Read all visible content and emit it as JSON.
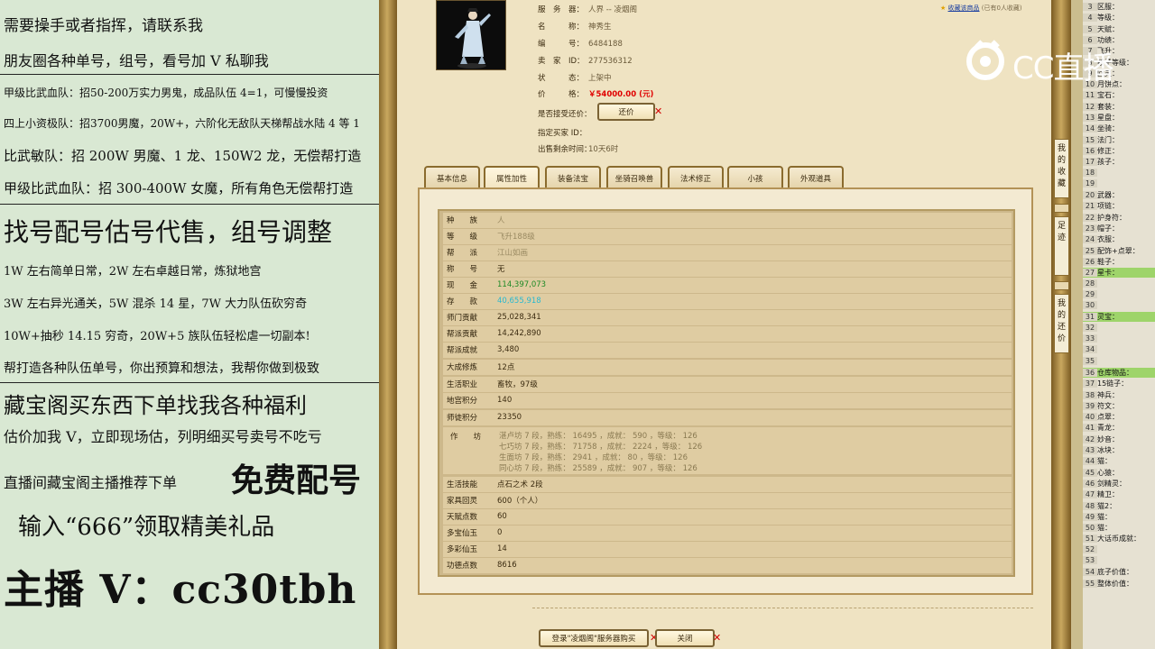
{
  "left_panel": {
    "lines": [
      "需要操手或者指挥，请联系我",
      "朋友圈各种单号，组号，看号加 V 私聊我",
      "甲级比武血队：招50-200万实力男鬼，成品队伍 4=1，可慢慢投资",
      "四上小资极队：招3700男魔，20W+，六阶化无敌队天梯帮战水陆 4 等 1",
      "比武敏队：招 200W 男魔、1 龙、150W2 龙，无偿帮打造",
      "甲级比武血队：招 300-400W 女魔，所有角色无偿帮打造",
      "找号配号估号代售，组号调整",
      "1W 左右简单日常，2W 左右卓越日常，炼狱地宫",
      "3W 左右异光通关，5W 混杀 14 星，7W 大力队伍砍穷奇",
      "10W+抽秒 14.15 穷奇，20W+5 族队伍轻松虐一切副本!",
      "帮打造各种队伍单号，你出预算和想法，我帮你做到极致",
      "藏宝阁买东西下单找我各种福利",
      "估价加我 V，立即现场估，列明细买号卖号不吃亏",
      "直播间藏宝阁主播推荐下单",
      "免费配号",
      "输入“666”领取精美礼品",
      "主播 V：cc30tbh"
    ]
  },
  "header": {
    "favorite_link": "收藏该商品",
    "favorite_count": "(已有0人收藏)",
    "rows": [
      {
        "label": "服　务　器：",
        "value": "人界 -- 凌烟阁"
      },
      {
        "label": "名　　　称：",
        "value": "神秀生"
      },
      {
        "label": "编　　　号：",
        "value": "6484188"
      },
      {
        "label": "卖　家　ID：",
        "value": "277536312"
      },
      {
        "label": "状　　　态：",
        "value": "上架中"
      },
      {
        "label": "价　　　格：",
        "value": "￥54000.00 (元)"
      },
      {
        "label": "是否接受还价：",
        "value": ""
      },
      {
        "label": "指定买家 ID：",
        "value": ""
      },
      {
        "label": "出售剩余时间：",
        "value": "10天6时"
      }
    ],
    "bargain_button": "还价"
  },
  "tabs": [
    "基本信息",
    "属性加性",
    "装备法宝",
    "坐骑召唤兽",
    "法术修正",
    "小孩",
    "外观道具"
  ],
  "table": {
    "rows": [
      {
        "label": "种　　族",
        "value": "人",
        "style": "muted"
      },
      {
        "label": "等　　级",
        "value": "飞升188级",
        "style": "muted"
      },
      {
        "label": "帮　　派",
        "value": "江山如画",
        "style": "muted"
      },
      {
        "label": "称　　号",
        "value": "无",
        "style": ""
      },
      {
        "label": "现　　金",
        "value": "114,397,073",
        "style": "green"
      },
      {
        "label": "存　　款",
        "value": "40,655,918",
        "style": "cyan"
      },
      {
        "label": "师门贡献",
        "value": "25,028,341",
        "style": ""
      },
      {
        "label": "帮派贡献",
        "value": "14,242,890",
        "style": ""
      },
      {
        "label": "帮派成就",
        "value": "3,480",
        "style": ""
      },
      {
        "label": "大成修炼",
        "value": "12点",
        "style": ""
      },
      {
        "label": "生活职业",
        "value": "畜牧，97级",
        "style": ""
      },
      {
        "label": "地宫积分",
        "value": "140",
        "style": ""
      },
      {
        "label": "师徒积分",
        "value": "23350",
        "style": ""
      }
    ],
    "workshop_label": "作　　坊",
    "workshop": [
      "湛卢坊 7 段，熟练： 16495 ，成就： 590 ，等级： 126",
      "七巧坊 7 段，熟练： 71758 ，成就： 2224 ，等级： 126",
      "生面坊 7 段，熟练： 2941 ，成就： 80 ，等级： 126",
      "同心坊 7 段，熟练： 25589 ，成就： 907 ，等级： 126"
    ],
    "rows2": [
      {
        "label": "生活技能",
        "value": "点石之术 2段"
      },
      {
        "label": "家具回灵",
        "value": "600（个人）"
      },
      {
        "label": "天赋点数",
        "value": "60"
      },
      {
        "label": "多宝仙玉",
        "value": "0"
      },
      {
        "label": "多彩仙玉",
        "value": "14"
      },
      {
        "label": "功德点数",
        "value": "8616"
      }
    ]
  },
  "bottom_buttons": {
    "login_buy": "登录\"凌烟阁\"服务器购买",
    "close": "关闭"
  },
  "side_tabs": [
    "我的收藏",
    "足迹",
    "我的还价"
  ],
  "watermark": "CC直播",
  "right_list": [
    {
      "n": "3",
      "t": "区服："
    },
    {
      "n": "4",
      "t": "等级："
    },
    {
      "n": "5",
      "t": "天赋："
    },
    {
      "n": "6",
      "t": "功绩："
    },
    {
      "n": "7",
      "t": "飞升："
    },
    {
      "n": "8",
      "t": "孩子等级："
    },
    {
      "n": "9",
      "t": "回灵："
    },
    {
      "n": "10",
      "t": "月饼点："
    },
    {
      "n": "11",
      "t": "宝石："
    },
    {
      "n": "12",
      "t": "套装："
    },
    {
      "n": "13",
      "t": "星盘："
    },
    {
      "n": "14",
      "t": "坐骑："
    },
    {
      "n": "15",
      "t": "法门："
    },
    {
      "n": "16",
      "t": "修正："
    },
    {
      "n": "17",
      "t": "孩子："
    },
    {
      "n": "18",
      "t": ""
    },
    {
      "n": "19",
      "t": ""
    },
    {
      "n": "20",
      "t": "武器："
    },
    {
      "n": "21",
      "t": "项链："
    },
    {
      "n": "22",
      "t": "护身符："
    },
    {
      "n": "23",
      "t": "帽子："
    },
    {
      "n": "24",
      "t": "衣服："
    },
    {
      "n": "25",
      "t": "配饰+点翠："
    },
    {
      "n": "26",
      "t": "鞋子："
    },
    {
      "n": "27",
      "t": "星卡：",
      "hl": true
    },
    {
      "n": "28",
      "t": ""
    },
    {
      "n": "29",
      "t": ""
    },
    {
      "n": "30",
      "t": ""
    },
    {
      "n": "31",
      "t": "灵宝：",
      "hl": true
    },
    {
      "n": "32",
      "t": ""
    },
    {
      "n": "33",
      "t": ""
    },
    {
      "n": "34",
      "t": ""
    },
    {
      "n": "35",
      "t": ""
    },
    {
      "n": "36",
      "t": "仓库物品：",
      "hl": true
    },
    {
      "n": "37",
      "t": "15链子："
    },
    {
      "n": "38",
      "t": "神兵："
    },
    {
      "n": "39",
      "t": "符文："
    },
    {
      "n": "40",
      "t": "点翠："
    },
    {
      "n": "41",
      "t": "青龙："
    },
    {
      "n": "42",
      "t": "妙音："
    },
    {
      "n": "43",
      "t": "冰块："
    },
    {
      "n": "44",
      "t": "猫："
    },
    {
      "n": "45",
      "t": "心猿："
    },
    {
      "n": "46",
      "t": "剑精灵："
    },
    {
      "n": "47",
      "t": "精卫："
    },
    {
      "n": "48",
      "t": "猫2："
    },
    {
      "n": "49",
      "t": "猫："
    },
    {
      "n": "50",
      "t": "猫："
    },
    {
      "n": "51",
      "t": "大话币成就："
    },
    {
      "n": "52",
      "t": ""
    },
    {
      "n": "53",
      "t": ""
    },
    {
      "n": "54",
      "t": "底子价值："
    },
    {
      "n": "55",
      "t": "整体价值："
    }
  ]
}
